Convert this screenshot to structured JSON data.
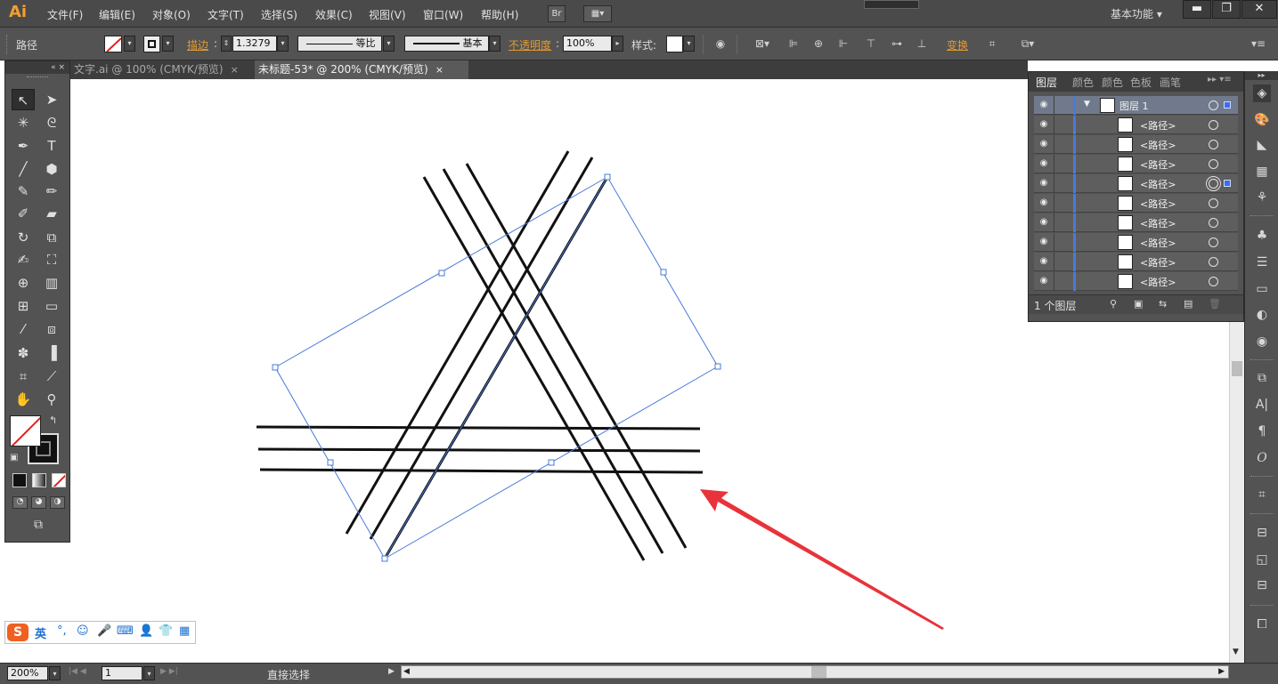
{
  "app": {
    "logo": "Ai",
    "brand_color": "#f0a030"
  },
  "menu": {
    "items": [
      "文件(F)",
      "编辑(E)",
      "对象(O)",
      "文字(T)",
      "选择(S)",
      "效果(C)",
      "视图(V)",
      "窗口(W)",
      "帮助(H)"
    ],
    "bridge_button": "Br",
    "workspace_label": "基本功能",
    "window_buttons": {
      "minimize": "▬",
      "restore": "❐",
      "close": "✕"
    }
  },
  "control": {
    "selection_type": "路径",
    "stroke_link": "描边",
    "stroke_width": "1.3279",
    "profile_label": "等比",
    "brush_label": "基本",
    "opacity_link": "不透明度",
    "opacity_value": "100%",
    "style_label": "样式",
    "transform_link": "变换"
  },
  "tabs": [
    {
      "label": "文字.ai @ 100% (CMYK/预览)",
      "close": "×"
    },
    {
      "label": "未标题-53* @ 200% (CMYK/预览)",
      "close": "×"
    }
  ],
  "tools_panel": {
    "collapse": "«  ×",
    "tools": [
      {
        "name": "selection-tool",
        "glyph": "↖",
        "selected": true
      },
      {
        "name": "direct-selection-tool",
        "glyph": "➤"
      },
      {
        "name": "magic-wand-tool",
        "glyph": "✳"
      },
      {
        "name": "lasso-tool",
        "glyph": "ᘓ"
      },
      {
        "name": "pen-tool",
        "glyph": "✒"
      },
      {
        "name": "type-tool",
        "glyph": "T"
      },
      {
        "name": "line-tool",
        "glyph": "╱"
      },
      {
        "name": "ellipse-tool",
        "glyph": "⬢"
      },
      {
        "name": "paintbrush-tool",
        "glyph": "✎"
      },
      {
        "name": "pencil-tool",
        "glyph": "✏"
      },
      {
        "name": "blob-brush-tool",
        "glyph": "✐"
      },
      {
        "name": "eraser-tool",
        "glyph": "▰"
      },
      {
        "name": "rotate-tool",
        "glyph": "↻"
      },
      {
        "name": "scale-tool",
        "glyph": "⧉"
      },
      {
        "name": "warp-tool",
        "glyph": "✍"
      },
      {
        "name": "free-transform-tool",
        "glyph": "⛶"
      },
      {
        "name": "shape-builder-tool",
        "glyph": "⊕"
      },
      {
        "name": "perspective-grid-tool",
        "glyph": "▥"
      },
      {
        "name": "mesh-tool",
        "glyph": "⊞"
      },
      {
        "name": "gradient-tool",
        "glyph": "▭"
      },
      {
        "name": "eyedropper-tool",
        "glyph": "⁄"
      },
      {
        "name": "blend-tool",
        "glyph": "⧈"
      },
      {
        "name": "symbol-sprayer-tool",
        "glyph": "✽"
      },
      {
        "name": "column-graph-tool",
        "glyph": "▐"
      },
      {
        "name": "artboard-tool",
        "glyph": "⌗"
      },
      {
        "name": "slice-tool",
        "glyph": "⟋"
      },
      {
        "name": "hand-tool",
        "glyph": "✋"
      },
      {
        "name": "zoom-tool",
        "glyph": "⚲"
      }
    ],
    "swap_glyph": "↰",
    "default_glyph": "▣",
    "screen_mode_glyph": "⧉"
  },
  "layers_panel": {
    "tabs": [
      "图层",
      "颜色",
      "颜色",
      "色板",
      "画笔"
    ],
    "menu_glyph": "▸▸ ▾≡",
    "top_layer": {
      "name": "图层 1",
      "expand": "▼"
    },
    "sublayers": [
      "<路径>",
      "<路径>",
      "<路径>",
      "<路径>",
      "<路径>",
      "<路径>",
      "<路径>",
      "<路径>",
      "<路径>"
    ],
    "eye_glyph": "◉",
    "footer_label": "1 个图层",
    "footer_icons": [
      "⚲",
      "▣",
      "⇆",
      "▤",
      "🗑"
    ],
    "selection_color": "#3a6cf5"
  },
  "right_dock": {
    "icons": [
      {
        "name": "layers-icon",
        "glyph": "◈"
      },
      {
        "name": "color-icon",
        "glyph": "🎨"
      },
      {
        "name": "color-guide-icon",
        "glyph": "◣"
      },
      {
        "name": "swatches-icon",
        "glyph": "▦"
      },
      {
        "name": "brushes-icon",
        "glyph": "⚘"
      },
      {
        "name": "symbols-icon",
        "glyph": "♣"
      },
      {
        "name": "stroke-icon",
        "glyph": "☰"
      },
      {
        "name": "gradient-icon",
        "glyph": "▭"
      },
      {
        "name": "transparency-icon",
        "glyph": "◐"
      },
      {
        "name": "appearance-icon",
        "glyph": "◉"
      },
      {
        "name": "graphic-styles-icon",
        "glyph": "⧉"
      },
      {
        "name": "character-icon",
        "glyph": "A|"
      },
      {
        "name": "paragraph-icon",
        "glyph": "¶"
      },
      {
        "name": "opentype-icon",
        "glyph": "O"
      },
      {
        "name": "transform-icon",
        "glyph": "⌗"
      },
      {
        "name": "align-icon",
        "glyph": "⊟"
      },
      {
        "name": "pathfinder-icon",
        "glyph": "◱"
      },
      {
        "name": "artboards-icon",
        "glyph": "⧠"
      }
    ]
  },
  "status": {
    "zoom": "200%",
    "artboard_number": "1",
    "current_tool": "直接选择"
  },
  "ime": {
    "logo": "S",
    "lang": "英",
    "items": [
      "°,",
      "☺",
      "🎤",
      "⌨",
      "👤",
      "👕",
      "▦"
    ]
  },
  "canvas": {
    "selection_color": "#4a7ad8",
    "annotation_arrow_color": "#e8333a"
  }
}
